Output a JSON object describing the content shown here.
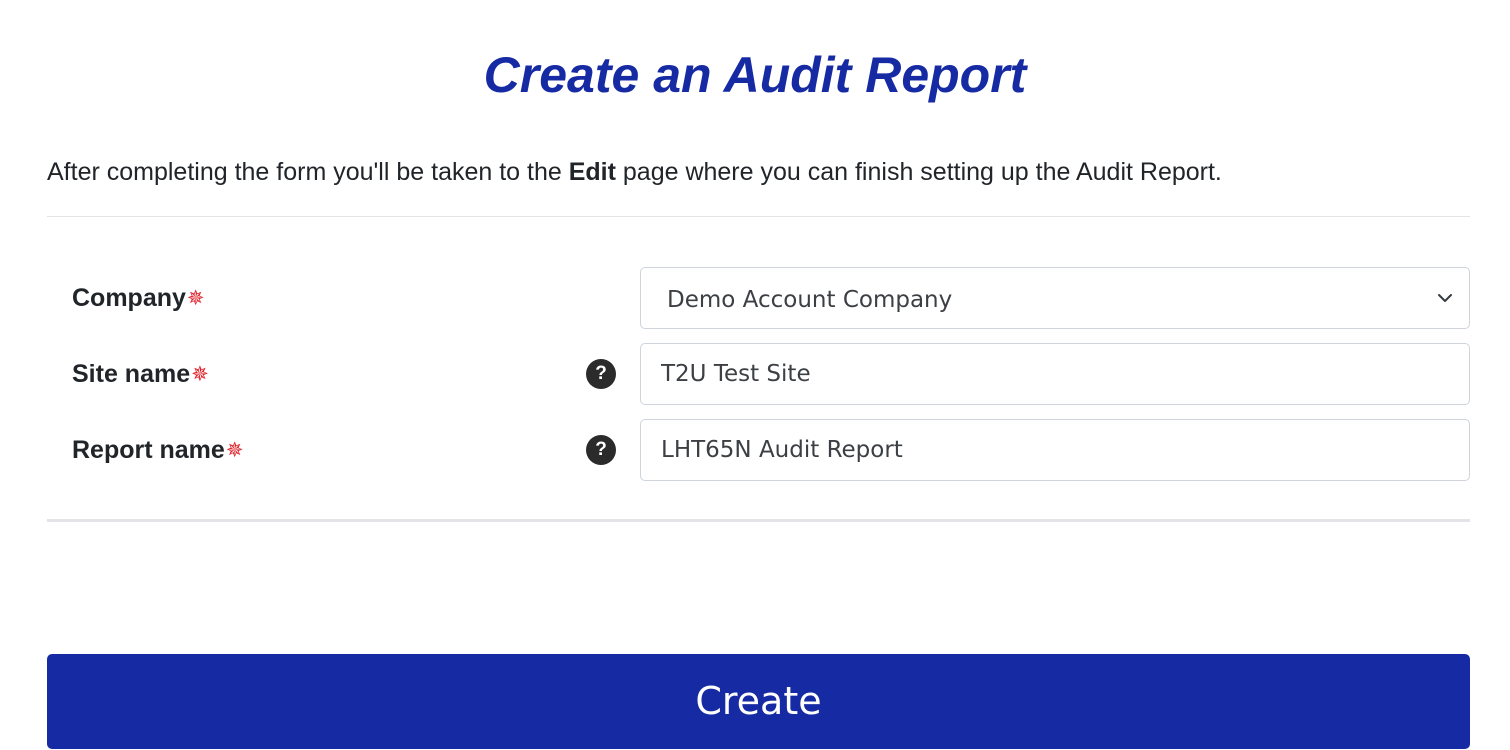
{
  "page": {
    "title": "Create an Audit Report",
    "intro": {
      "before": "After completing the form you'll be taken to the ",
      "bold": "Edit",
      "after": " page where you can finish setting up the Audit Report."
    }
  },
  "form": {
    "required_marker": "✵",
    "help_glyph": "?",
    "company": {
      "label": "Company",
      "selected": "Demo Account Company"
    },
    "site_name": {
      "label": "Site name",
      "value": "T2U Test Site"
    },
    "report_name": {
      "label": "Report name",
      "value": "LHT65N Audit Report"
    }
  },
  "actions": {
    "create_label": "Create"
  },
  "colors": {
    "accent": "#162ba3",
    "required": "#e0242e",
    "divider": "#e2e4e7"
  },
  "icons": {
    "help": "question-circle-icon",
    "required": "asterisk-icon",
    "dropdown": "chevron-down-icon"
  }
}
